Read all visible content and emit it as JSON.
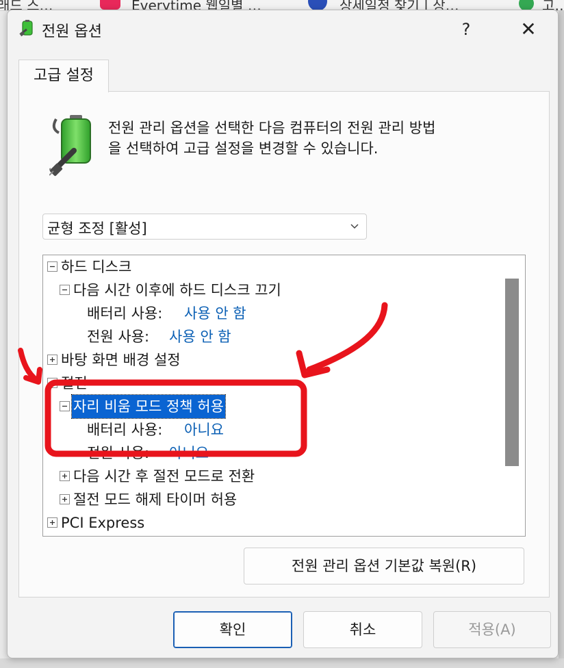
{
  "background": {
    "tabs": [
      "래드 스…",
      "Everytime 웹일별 …",
      "상세일정 찾기 | 상…",
      "고…"
    ]
  },
  "window": {
    "title": "전원 옵션",
    "help_label": "?",
    "close_label": "✕"
  },
  "tab": {
    "label": "고급 설정"
  },
  "description": {
    "line1": "전원 관리 옵션을 선택한 다음 컴퓨터의 전원 관리 방법",
    "line2": "을 선택하여 고급 설정을 변경할 수 있습니다."
  },
  "plan_select": {
    "value": "균형 조정 [활성]"
  },
  "tree": {
    "items": [
      {
        "expander": "-",
        "label": "하드 디스크"
      },
      {
        "expander": "-",
        "label": "다음 시간 이후에 하드 디스크 끄기"
      },
      {
        "label": "배터리 사용:",
        "value": "사용 안 함"
      },
      {
        "label": "전원 사용:",
        "value": "사용 안 함"
      },
      {
        "expander": "+",
        "label": "바탕 화면 배경 설정"
      },
      {
        "expander": "-",
        "label": "절전"
      },
      {
        "expander": "-",
        "label": "자리 비움 모드 정책 허용",
        "selected": true
      },
      {
        "label": "배터리 사용:",
        "value": "아니요"
      },
      {
        "label": "전원 사용:",
        "value": "아니요"
      },
      {
        "expander": "+",
        "label": "다음 시간 후 절전 모드로 전환"
      },
      {
        "expander": "+",
        "label": "절전 모드 해제 타이머 허용"
      },
      {
        "expander": "+",
        "label": "PCI Express"
      }
    ]
  },
  "buttons": {
    "restore": "전원 관리 옵션 기본값 복원(R)",
    "ok": "확인",
    "cancel": "취소",
    "apply": "적용(A)"
  },
  "colors": {
    "annotation": "#e8141c",
    "selection": "#0a64d2",
    "value_text": "#0a5fb4"
  }
}
